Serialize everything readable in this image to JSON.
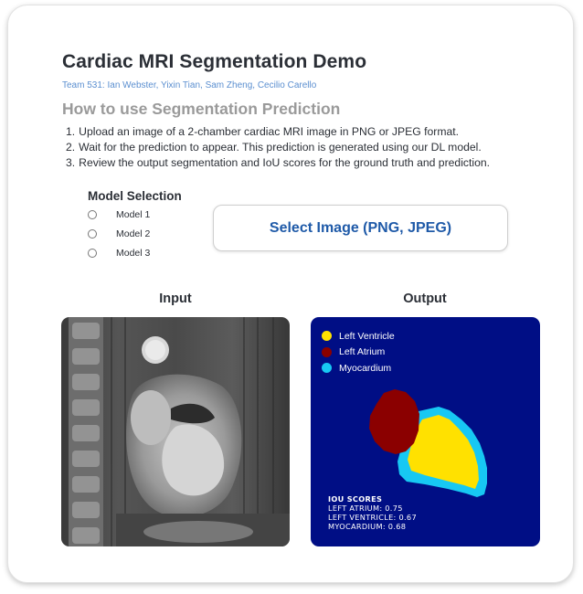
{
  "page": {
    "title": "Cardiac MRI Segmentation Demo",
    "team": "Team 531: Ian Webster, Yixin Tian, Sam Zheng, Cecilio Carello",
    "howto_heading": "How to use Segmentation Prediction",
    "steps": [
      {
        "num": "1.",
        "text": "Upload an image of a 2-chamber cardiac MRI image in PNG or JPEG format."
      },
      {
        "num": "2.",
        "text": "Wait for the prediction to appear. This prediction is generated using our DL model."
      },
      {
        "num": "3.",
        "text": "Review the output segmentation and IoU scores for the ground truth and prediction."
      }
    ]
  },
  "model_selection": {
    "title": "Model Selection",
    "options": [
      "Model 1",
      "Model 2",
      "Model 3"
    ],
    "selected": null
  },
  "select_image_button": {
    "label": "Select Image (PNG, JPEG)"
  },
  "input_panel": {
    "label": "Input"
  },
  "output_panel": {
    "label": "Output",
    "background_color": "#000e85",
    "legend": [
      {
        "label": "Left Ventricle",
        "color": "#ffe100"
      },
      {
        "label": "Left Atrium",
        "color": "#8b0000"
      },
      {
        "label": "Myocardium",
        "color": "#17c8f3"
      }
    ],
    "iou": {
      "title": "IOU SCORES",
      "lines": [
        "LEFT ATRIUM: 0.75",
        "LEFT VENTRICLE: 0.67",
        "MYOCARDIUM: 0.68"
      ]
    }
  },
  "colors": {
    "title": "#2b2f36",
    "team_link": "#5b8fd0",
    "subheading": "#9a9a9a",
    "button_text": "#1f5aa8"
  }
}
